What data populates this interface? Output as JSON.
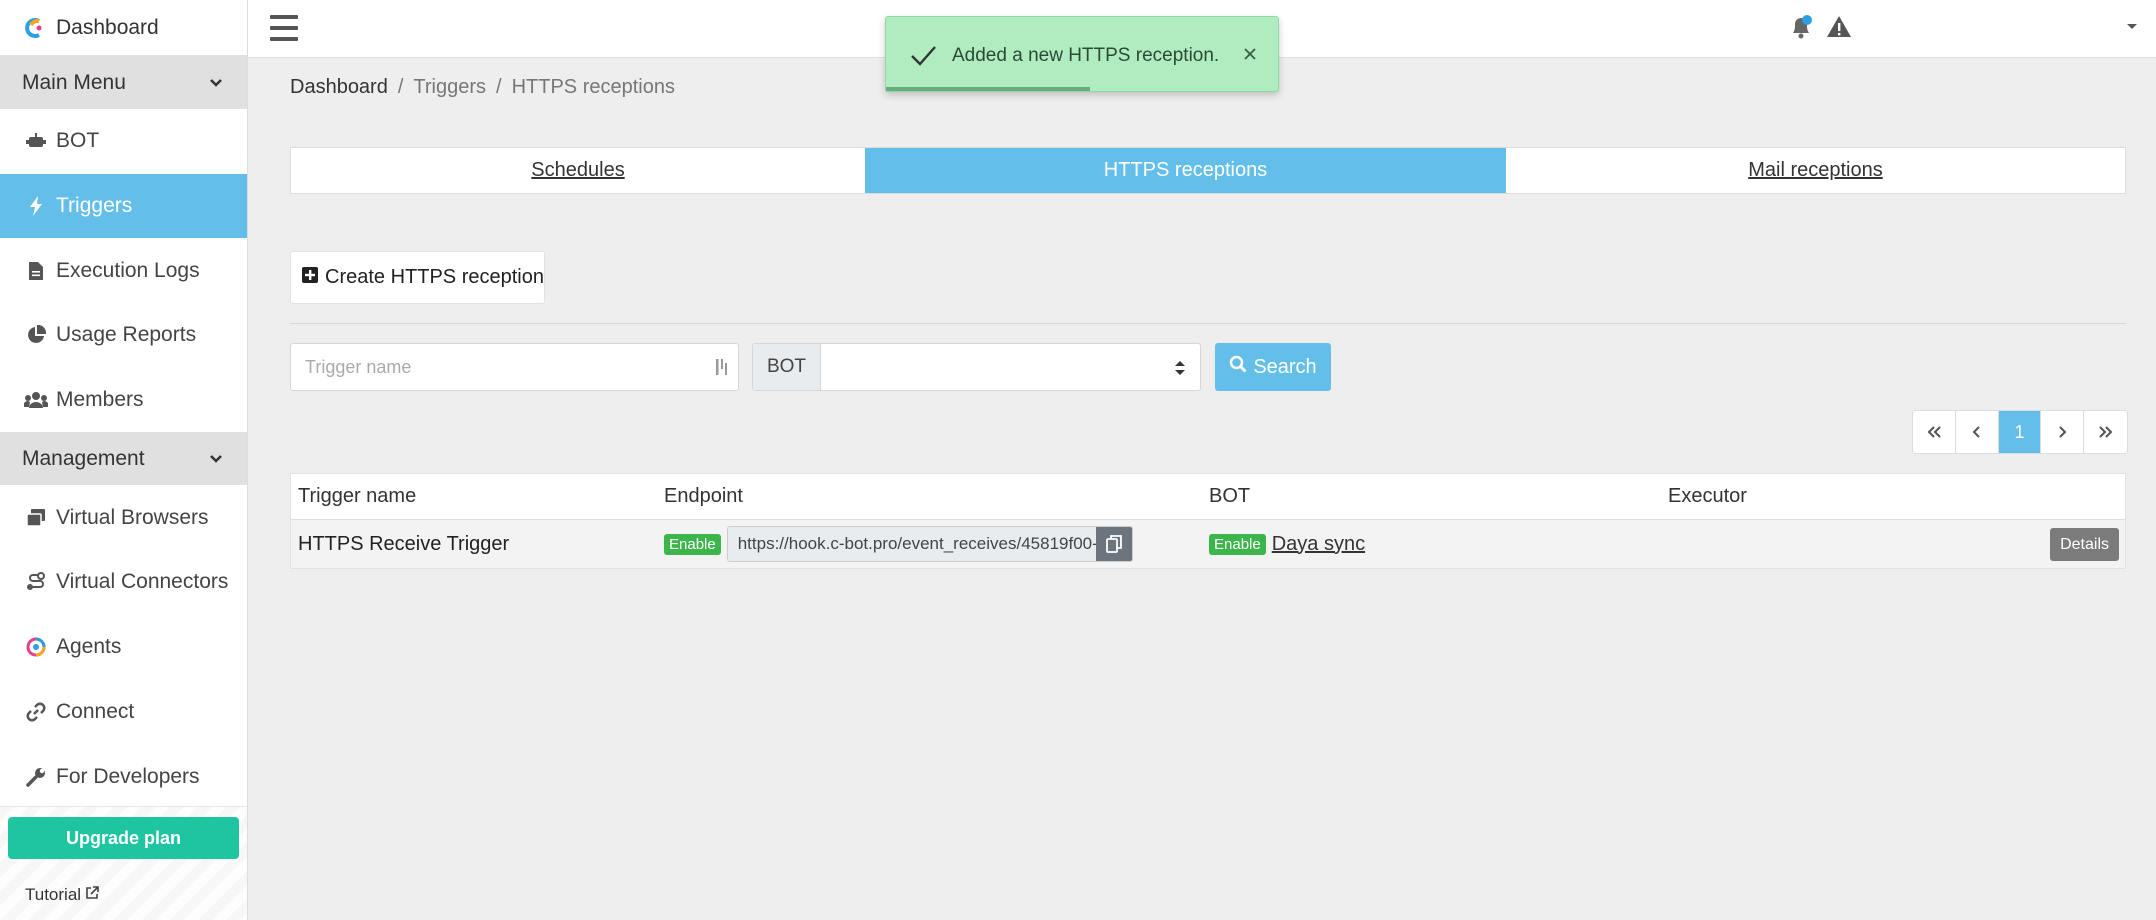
{
  "sidebar": {
    "brand": "Dashboard",
    "sections": [
      {
        "label": "Main Menu"
      },
      {
        "label": "Management"
      }
    ],
    "main_items": [
      {
        "label": "BOT",
        "icon": "robot-icon"
      },
      {
        "label": "Triggers",
        "icon": "bolt-icon"
      },
      {
        "label": "Execution Logs",
        "icon": "document-icon"
      },
      {
        "label": "Usage Reports",
        "icon": "pie-chart-icon"
      },
      {
        "label": "Members",
        "icon": "users-icon"
      }
    ],
    "management_items": [
      {
        "label": "Virtual Browsers",
        "icon": "browser-windows-icon"
      },
      {
        "label": "Virtual Connectors",
        "icon": "route-icon"
      },
      {
        "label": "Agents",
        "icon": "agent-logo-icon"
      },
      {
        "label": "Connect",
        "icon": "link-icon"
      },
      {
        "label": "For Developers",
        "icon": "wrench-icon"
      }
    ],
    "upgrade_label": "Upgrade plan",
    "tutorial_label": "Tutorial"
  },
  "toast": {
    "message": "Added a new HTTPS reception."
  },
  "breadcrumb": [
    "Dashboard",
    "Triggers",
    "HTTPS receptions"
  ],
  "tabs": [
    "Schedules",
    "HTTPS receptions",
    "Mail receptions"
  ],
  "create_button_label": "Create HTTPS reception",
  "filters": {
    "trigger_placeholder": "Trigger name",
    "bot_label": "BOT",
    "bot_value": "",
    "search_label": "Search"
  },
  "pagination": {
    "current_page": "1"
  },
  "table": {
    "headers": [
      "Trigger name",
      "Endpoint",
      "BOT",
      "Executor"
    ],
    "rows": [
      {
        "trigger_name": "HTTPS Receive Trigger",
        "endpoint_status": "Enable",
        "endpoint_url": "https://hook.c-bot.pro/event_receives/45819f00-(",
        "bot_status": "Enable",
        "bot_name": "Daya sync",
        "executor": "",
        "details_label": "Details"
      }
    ]
  },
  "colors": {
    "accent": "#63bfe9",
    "success": "#3cb64a",
    "upgrade": "#1fc5a0",
    "toast_bg": "#b1ecc1"
  }
}
